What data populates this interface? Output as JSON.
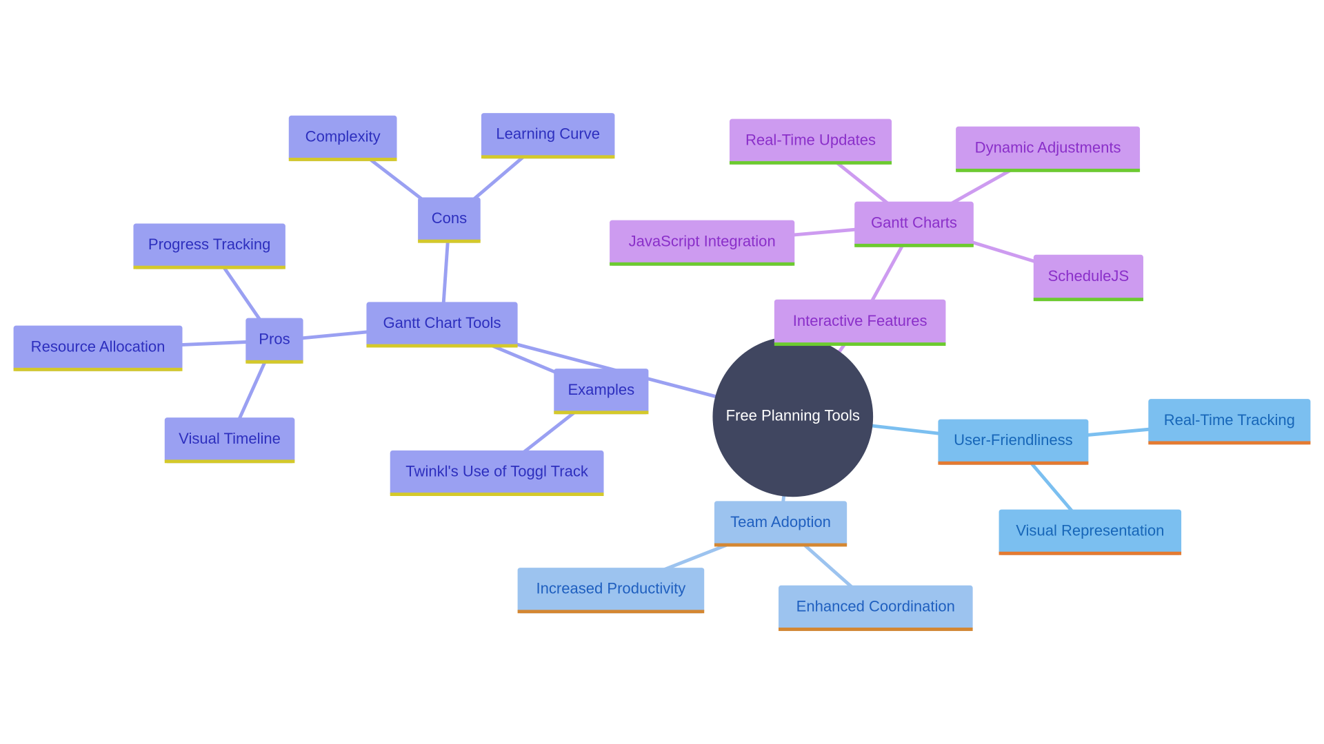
{
  "diagram": {
    "type": "mindmap",
    "root": {
      "label": "Free Planning Tools",
      "fill": "#404660",
      "text_color": "#ffffff"
    },
    "branches": [
      {
        "label": "Gantt Chart Tools",
        "theme": {
          "fill": "#9aa0f2",
          "text": "#2d2fbe",
          "accent": "#d4c92a",
          "edge": "#9aa0f2"
        },
        "children": [
          {
            "label": "Pros",
            "children": [
              {
                "label": "Progress Tracking"
              },
              {
                "label": "Resource Allocation"
              },
              {
                "label": "Visual Timeline"
              }
            ]
          },
          {
            "label": "Cons",
            "children": [
              {
                "label": "Complexity"
              },
              {
                "label": "Learning Curve"
              }
            ]
          },
          {
            "label": "Examples",
            "children": [
              {
                "label": "Twinkl's Use of Toggl Track"
              }
            ]
          }
        ]
      },
      {
        "label": "Interactive Features",
        "theme": {
          "fill": "#cd9bf0",
          "text": "#8a2fc9",
          "accent": "#6ccb2f",
          "edge": "#cd9bf0"
        },
        "children": [
          {
            "label": "Gantt Charts",
            "children": [
              {
                "label": "Real-Time Updates"
              },
              {
                "label": "Dynamic Adjustments"
              },
              {
                "label": "JavaScript Integration"
              },
              {
                "label": "ScheduleJS"
              }
            ]
          }
        ]
      },
      {
        "label": "User-Friendliness",
        "theme": {
          "fill": "#7bbff0",
          "text": "#1766b8",
          "accent": "#e57a30",
          "edge": "#7bbff0"
        },
        "children": [
          {
            "label": "Real-Time Tracking"
          },
          {
            "label": "Visual Representation"
          }
        ]
      },
      {
        "label": "Team Adoption",
        "theme": {
          "fill": "#9cc3ef",
          "text": "#1f5fbf",
          "accent": "#d48732",
          "edge": "#9cc3ef"
        },
        "children": [
          {
            "label": "Increased Productivity"
          },
          {
            "label": "Enhanced Coordination"
          }
        ]
      }
    ]
  }
}
